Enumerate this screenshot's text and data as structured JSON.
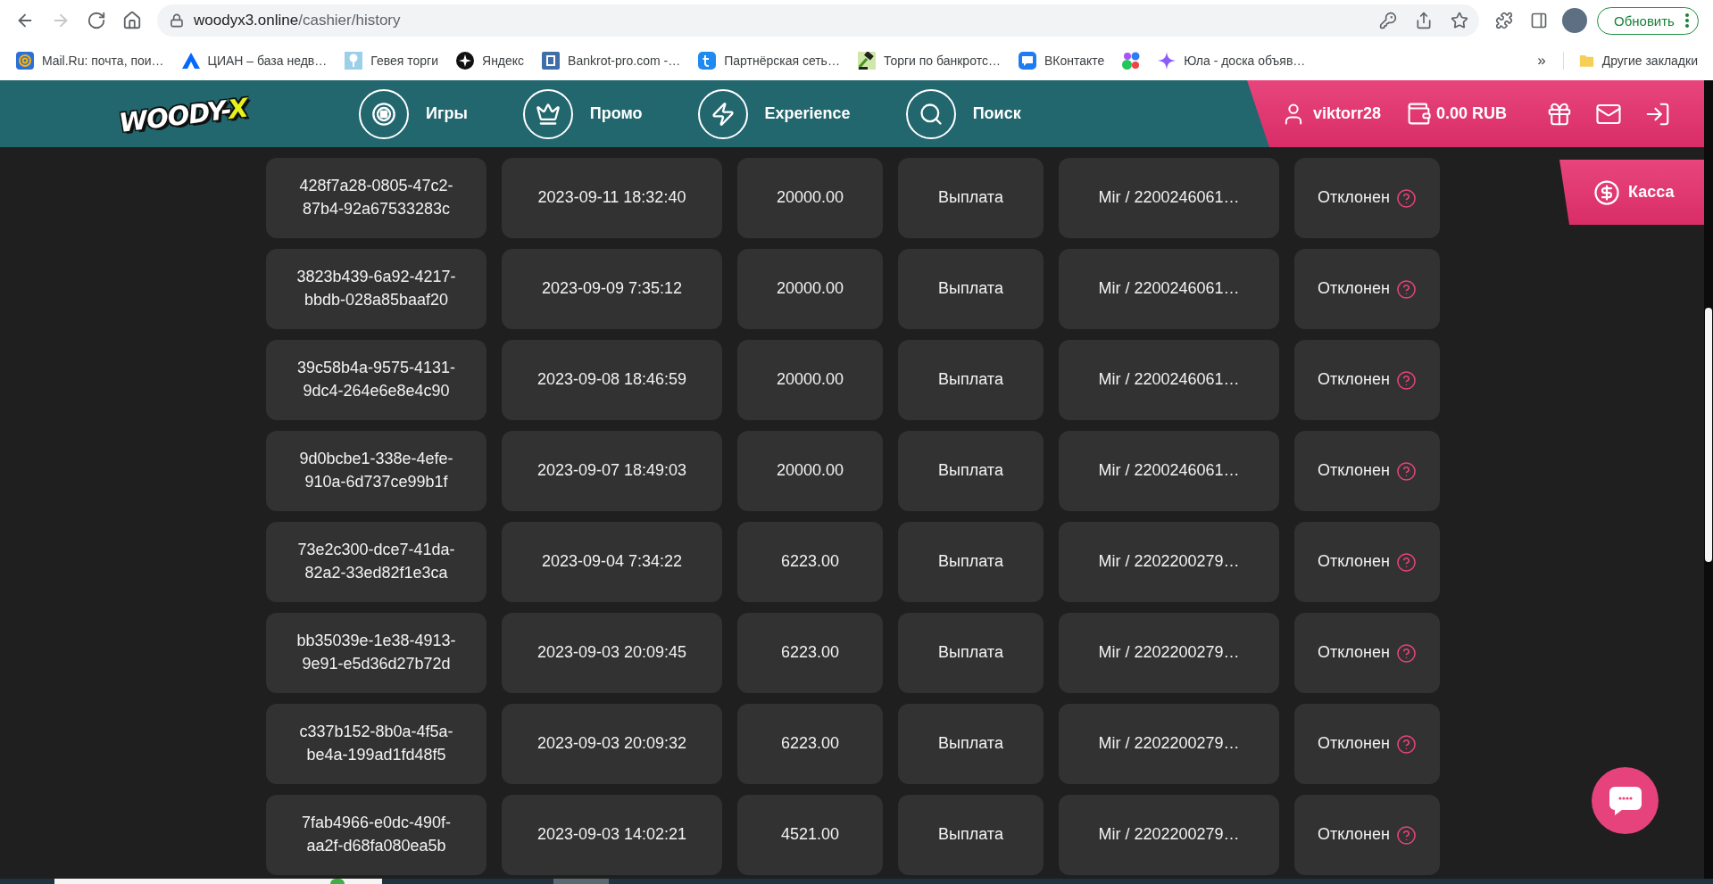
{
  "browser": {
    "nav_buttons": [
      {
        "kind": "back",
        "disabled": false
      },
      {
        "kind": "forward",
        "disabled": true
      },
      {
        "kind": "reload",
        "disabled": false
      },
      {
        "kind": "home",
        "disabled": false
      }
    ],
    "address": {
      "host": "woodyx3.online",
      "path": "/cashier/history"
    },
    "update_button": "Обновить"
  },
  "bookmarks": {
    "items": [
      {
        "kind": "link",
        "label": "Mail.Ru: почта, пои…"
      },
      {
        "kind": "link",
        "label": "ЦИАН – база недв…"
      },
      {
        "kind": "link",
        "label": "Гевея торги"
      },
      {
        "kind": "link",
        "label": "Яндекс"
      },
      {
        "kind": "link",
        "label": "Bankrot-pro.com -…"
      },
      {
        "kind": "link",
        "label": "Партнёрская сеть…"
      },
      {
        "kind": "link",
        "label": "Торги по банкротс…"
      },
      {
        "kind": "link",
        "label": "ВКонтакте"
      },
      {
        "kind": "icon"
      },
      {
        "kind": "link",
        "label": "Юла - доска объяв…"
      }
    ],
    "overflow": "»",
    "other": "Другие закладки"
  },
  "header": {
    "logo": {
      "main": "WOODY-",
      "accent": "X"
    },
    "nav": [
      {
        "label": "Игры"
      },
      {
        "label": "Промо"
      },
      {
        "label": "Experience"
      },
      {
        "label": "Поиск"
      }
    ],
    "user": "viktorr28",
    "balance": "0.00 RUB"
  },
  "cashier_button": "Касса",
  "history": {
    "rows": [
      {
        "id": "428f7a28-0805-47c2-87b4-92a67533283c",
        "date": "2023-09-11 18:32:40",
        "amount": "20000.00",
        "type": "Выплата",
        "method": "Mir / 2200246061…",
        "status": "Отклонен"
      },
      {
        "id": "3823b439-6a92-4217-bbdb-028a85baaf20",
        "date": "2023-09-09 7:35:12",
        "amount": "20000.00",
        "type": "Выплата",
        "method": "Mir / 2200246061…",
        "status": "Отклонен"
      },
      {
        "id": "39c58b4a-9575-4131-9dc4-264e6e8e4c90",
        "date": "2023-09-08 18:46:59",
        "amount": "20000.00",
        "type": "Выплата",
        "method": "Mir / 2200246061…",
        "status": "Отклонен"
      },
      {
        "id": "9d0bcbe1-338e-4efe-910a-6d737ce99b1f",
        "date": "2023-09-07 18:49:03",
        "amount": "20000.00",
        "type": "Выплата",
        "method": "Mir / 2200246061…",
        "status": "Отклонен"
      },
      {
        "id": "73e2c300-dce7-41da-82a2-33ed82f1e3ca",
        "date": "2023-09-04 7:34:22",
        "amount": "6223.00",
        "type": "Выплата",
        "method": "Mir / 2202200279…",
        "status": "Отклонен"
      },
      {
        "id": "bb35039e-1e38-4913-9e91-e5d36d27b72d",
        "date": "2023-09-03 20:09:45",
        "amount": "6223.00",
        "type": "Выплата",
        "method": "Mir / 2202200279…",
        "status": "Отклонен"
      },
      {
        "id": "c337b152-8b0a-4f5a-be4a-199ad1fd48f5",
        "date": "2023-09-03 20:09:32",
        "amount": "6223.00",
        "type": "Выплата",
        "method": "Mir / 2202200279…",
        "status": "Отклонен"
      },
      {
        "id": "7fab4966-e0dc-490f-aa2f-d68fa080ea5b",
        "date": "2023-09-03 14:02:21",
        "amount": "4521.00",
        "type": "Выплата",
        "method": "Mir / 2202200279…",
        "status": "Отклонен"
      }
    ]
  }
}
